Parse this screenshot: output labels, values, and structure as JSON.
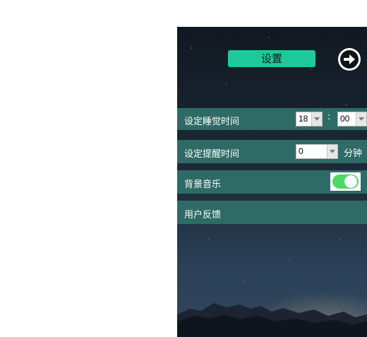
{
  "header": {
    "title": "设置",
    "next_icon": "arrow-right-circle-icon"
  },
  "settings": {
    "sleep_time": {
      "label": "设定睡觉时间",
      "hour": "18",
      "separator": ":",
      "minute": "00"
    },
    "reminder_time": {
      "label": "设定提醒时间",
      "value": "0",
      "unit": "分钟"
    },
    "background_music": {
      "label": "背景音乐",
      "enabled": true
    },
    "feedback": {
      "label": "用户反馈"
    }
  },
  "colors": {
    "accent": "#1dc99a",
    "row_bg": "#2f6b66",
    "toggle_on": "#4cd964"
  }
}
